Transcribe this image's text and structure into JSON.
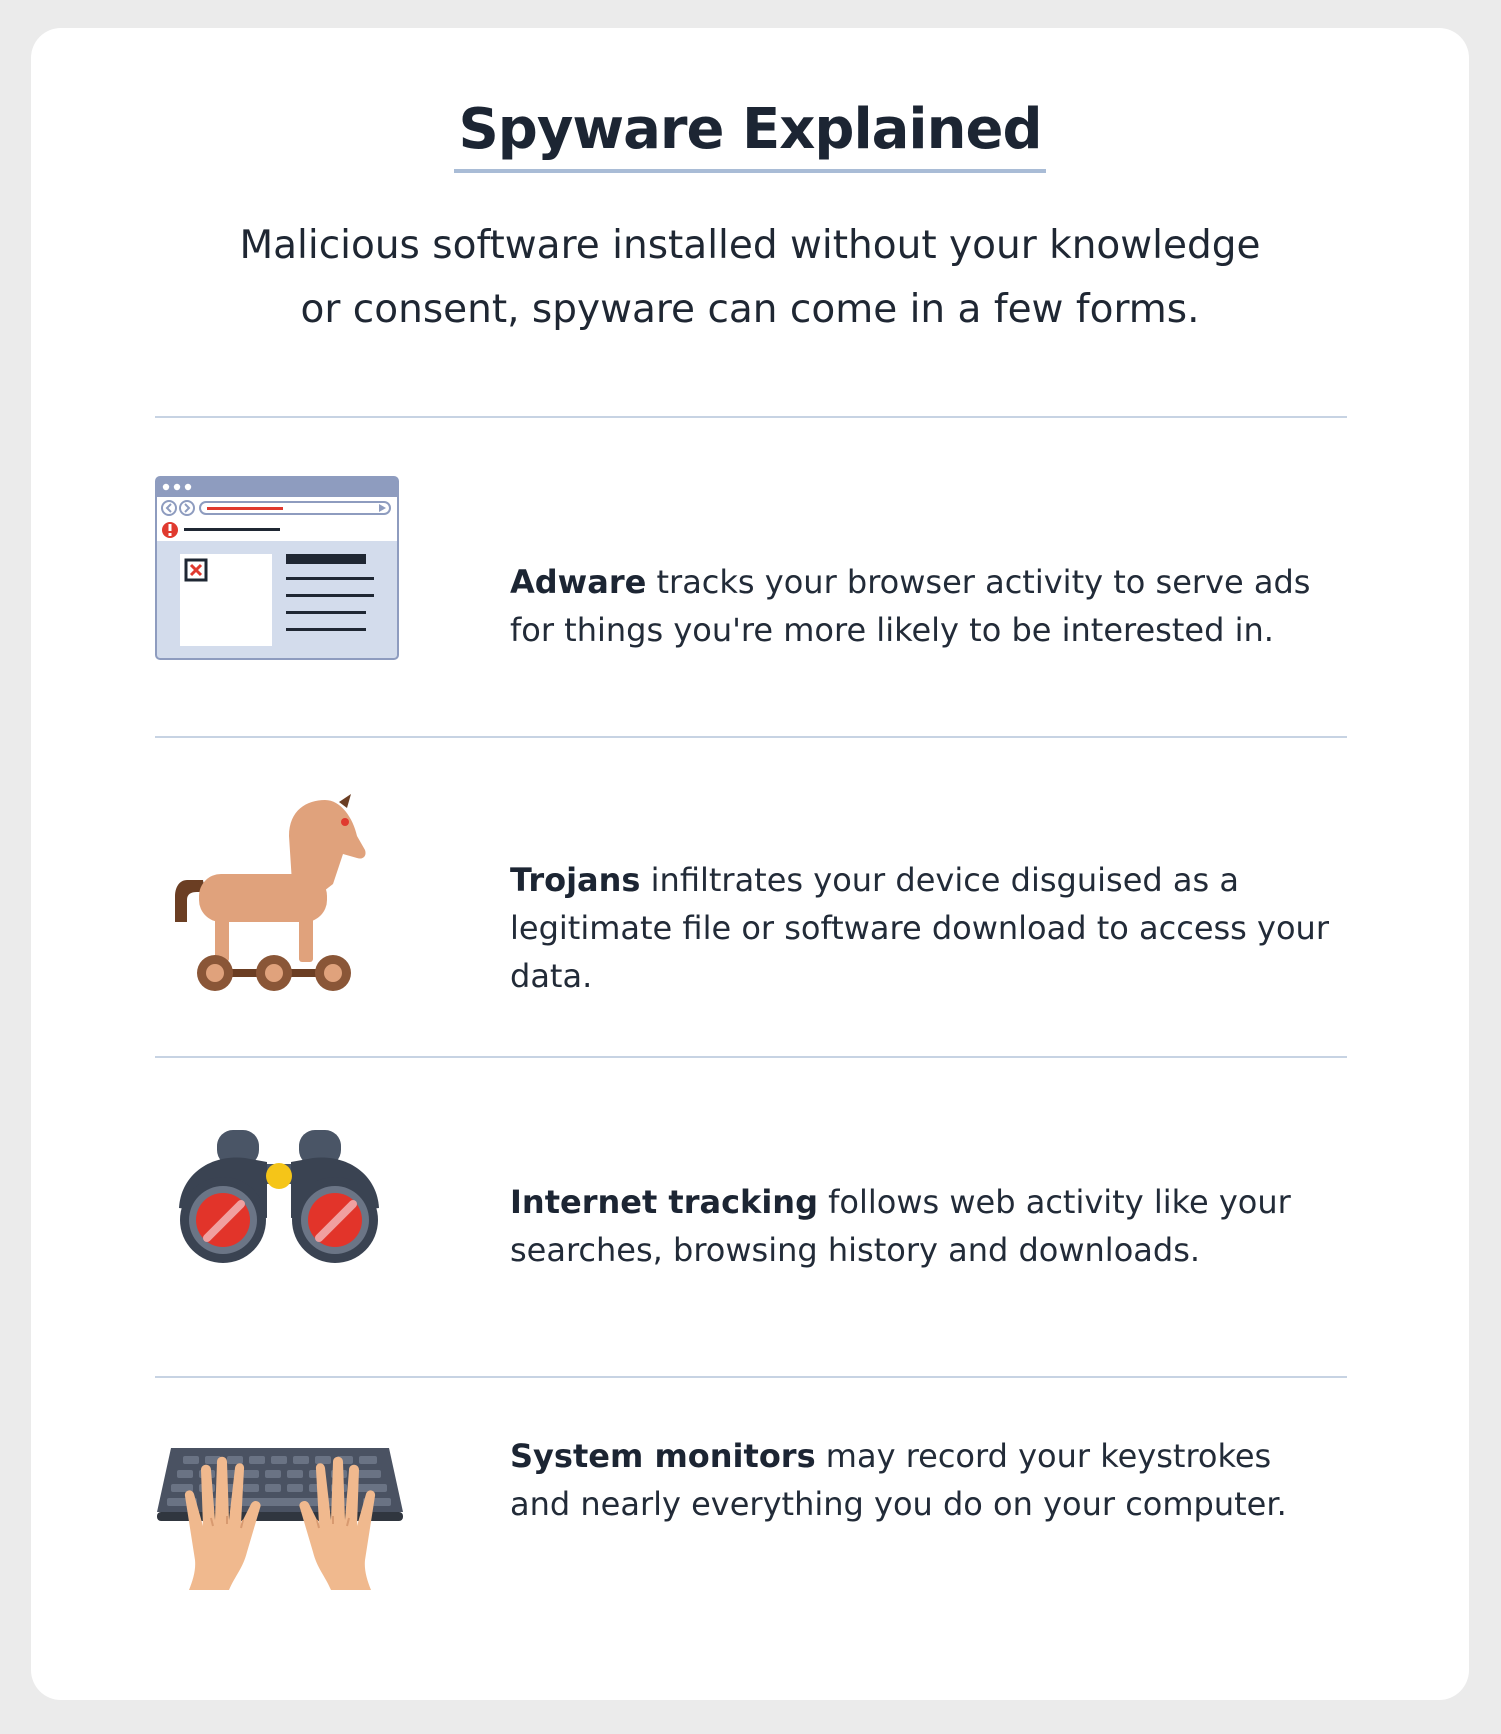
{
  "title": "Spyware Explained",
  "subtitle": {
    "line1": "Malicious software installed without your knowledge",
    "line2": "or consent, spyware can come in a few forms."
  },
  "items": [
    {
      "icon": "browser-adware-icon",
      "term": "Adware",
      "text": " tracks your browser activity to serve ads for things you're more likely to be interested in."
    },
    {
      "icon": "trojan-horse-icon",
      "term": "Trojans",
      "text": " infiltrates your device disguised as a legitimate file or software download to access your data."
    },
    {
      "icon": "binoculars-icon",
      "term": "Internet tracking",
      "text": " follows web activity like your searches, browsing history and downloads."
    },
    {
      "icon": "keyboard-hands-icon",
      "term": "System monitors",
      "text": " may record your keystrokes and nearly everything you do on your computer."
    }
  ],
  "colors": {
    "background": "#ebebeb",
    "card": "#ffffff",
    "title_underline": "#a9bcd6",
    "divider": "#c7d3e3",
    "text": "#222b38",
    "alert_red": "#e03a2f",
    "horse": "#e0a27c",
    "wheel": "#8a5637",
    "binocular_body": "#3a4352",
    "lens_red": "#e2342a",
    "keyboard": "#3f4654",
    "hand": "#f0b98e"
  }
}
